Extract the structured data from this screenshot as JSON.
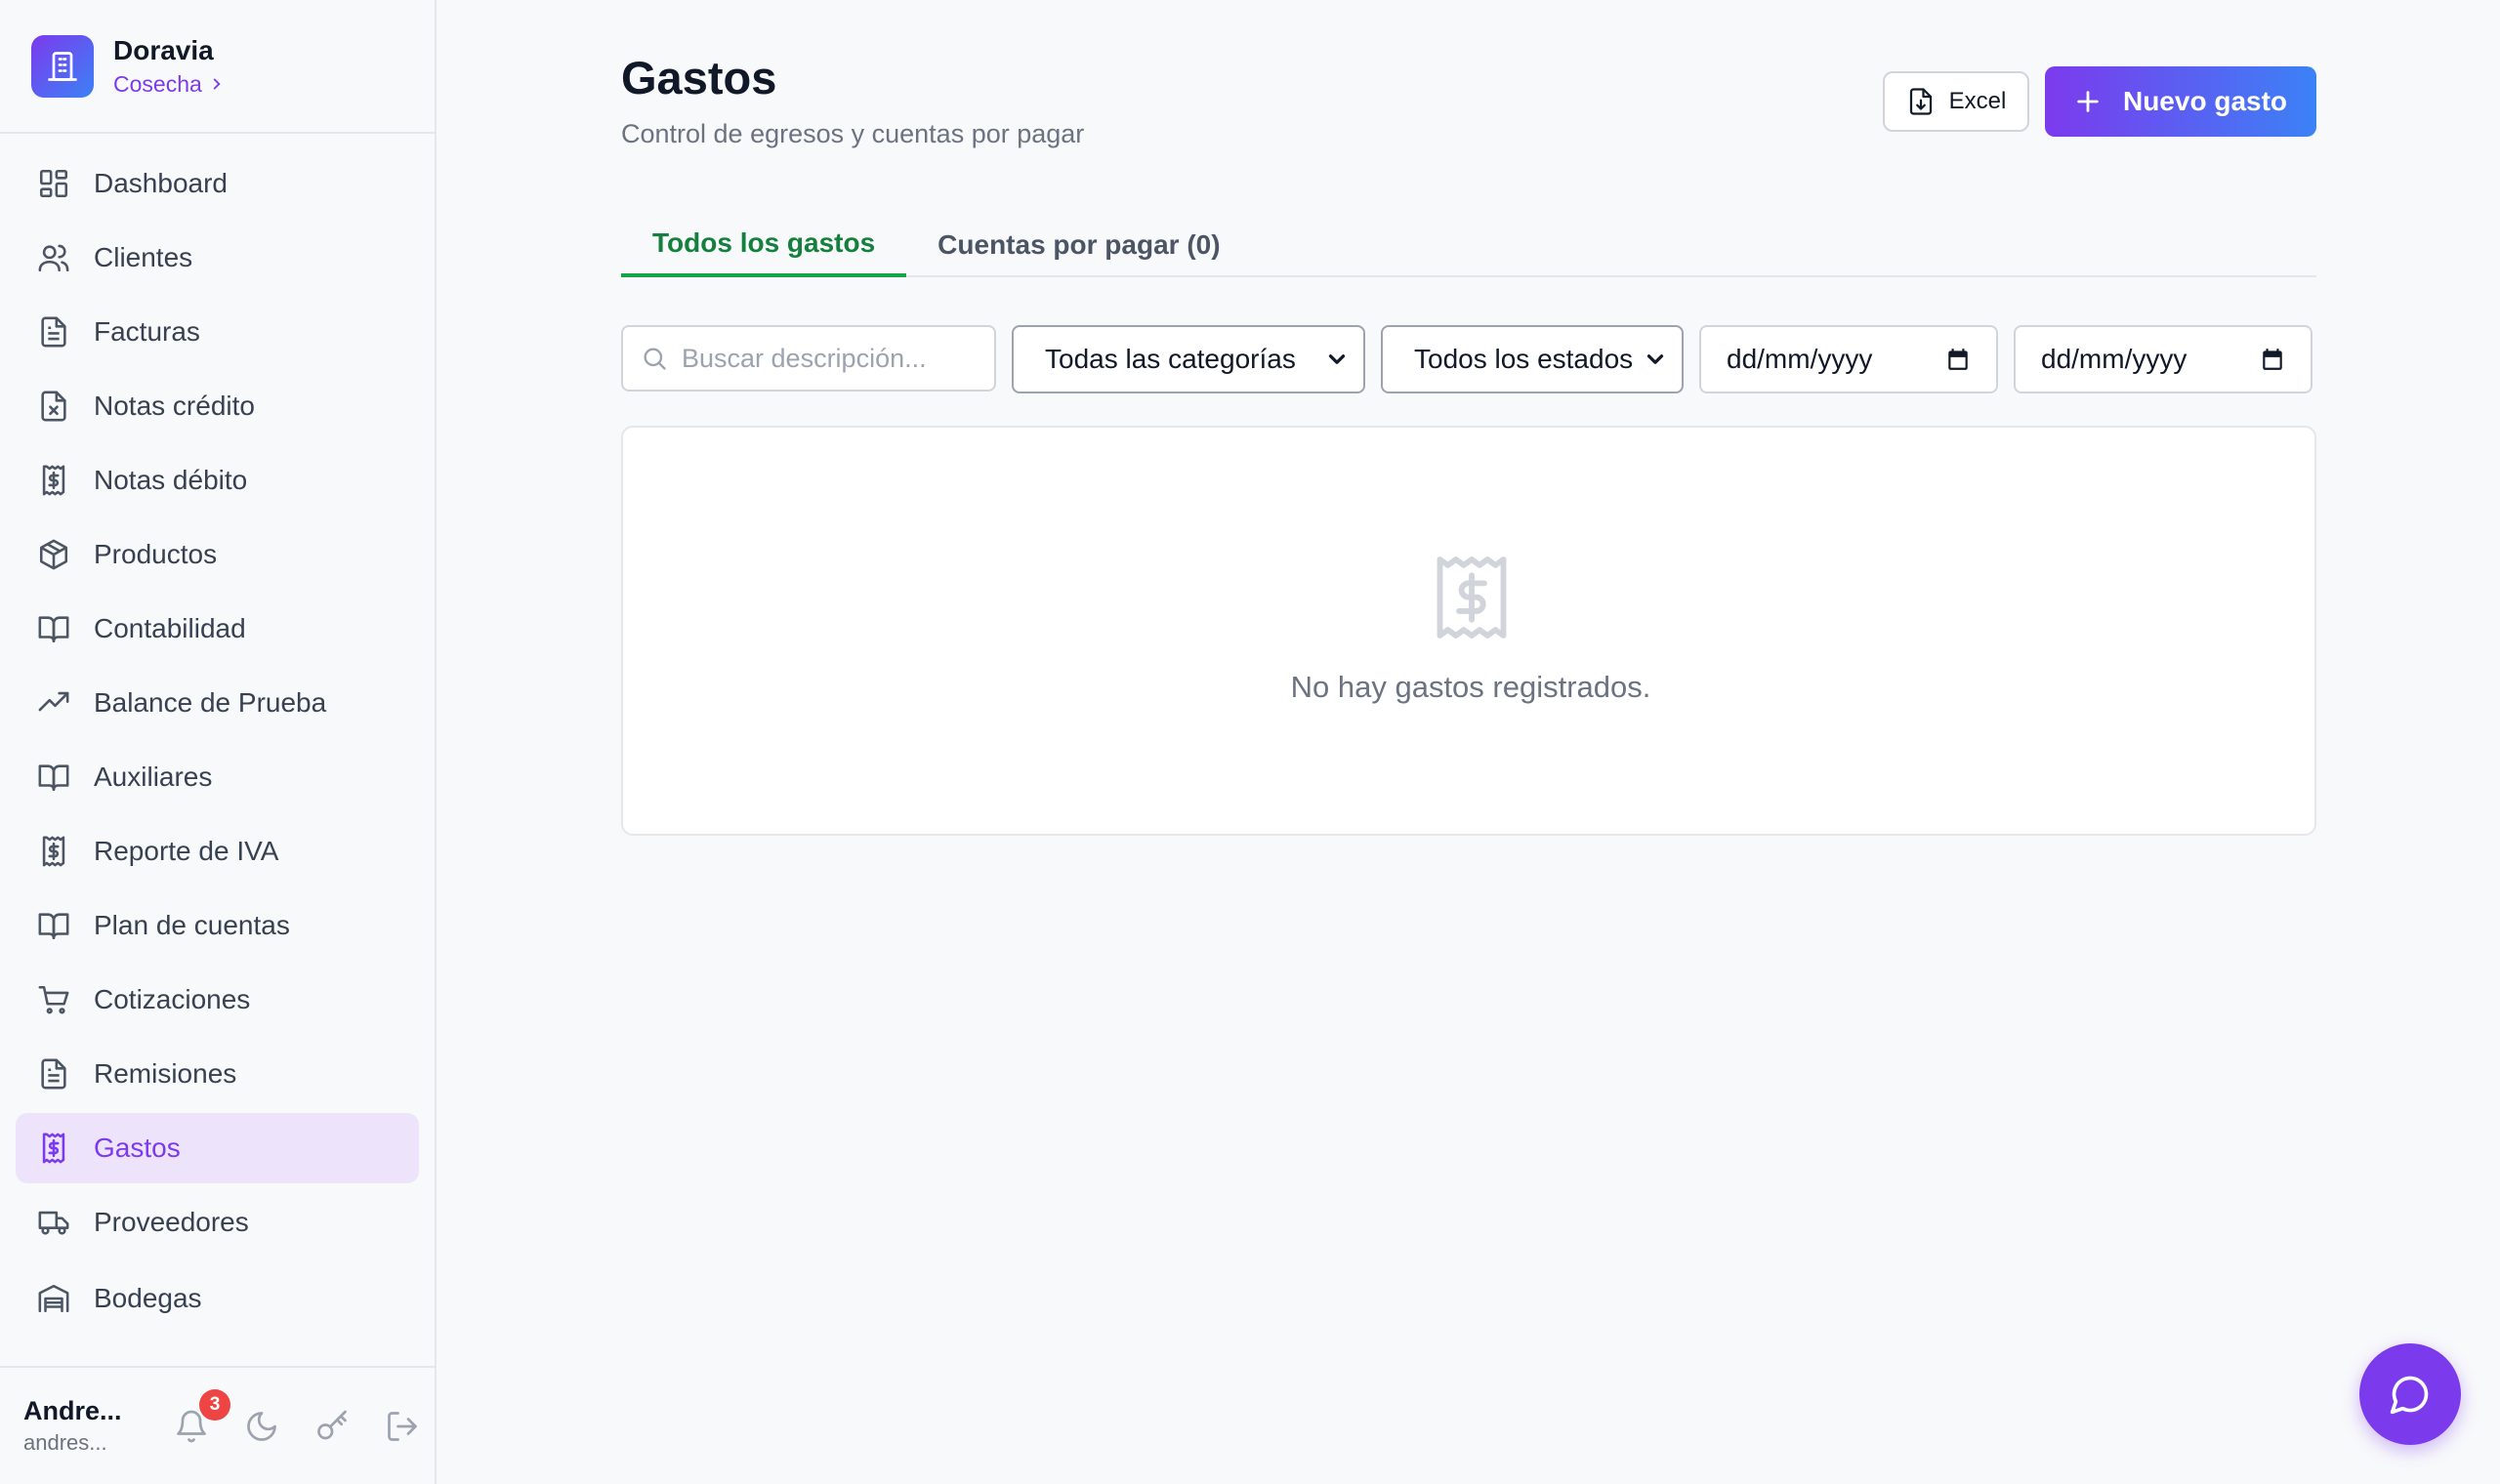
{
  "brand": {
    "name": "Doravia",
    "org": "Cosecha"
  },
  "nav": [
    {
      "label": "Dashboard",
      "icon": "dashboard-icon",
      "active": false
    },
    {
      "label": "Clientes",
      "icon": "users-icon",
      "active": false
    },
    {
      "label": "Facturas",
      "icon": "document-icon",
      "active": false
    },
    {
      "label": "Notas crédito",
      "icon": "document-x-icon",
      "active": false
    },
    {
      "label": "Notas débito",
      "icon": "receipt-dollar-icon",
      "active": false
    },
    {
      "label": "Productos",
      "icon": "box-icon",
      "active": false
    },
    {
      "label": "Contabilidad",
      "icon": "book-icon",
      "active": false
    },
    {
      "label": "Balance de Prueba",
      "icon": "trending-up-icon",
      "active": false
    },
    {
      "label": "Auxiliares",
      "icon": "book-icon",
      "active": false
    },
    {
      "label": "Reporte de IVA",
      "icon": "receipt-dollar-icon",
      "active": false
    },
    {
      "label": "Plan de cuentas",
      "icon": "book-icon",
      "active": false
    },
    {
      "label": "Cotizaciones",
      "icon": "cart-icon",
      "active": false
    },
    {
      "label": "Remisiones",
      "icon": "document-icon",
      "active": false
    },
    {
      "label": "Gastos",
      "icon": "receipt-dollar-icon",
      "active": true
    },
    {
      "label": "Proveedores",
      "icon": "truck-icon",
      "active": false
    },
    {
      "label": "Bodegas",
      "icon": "warehouse-icon",
      "active": false
    }
  ],
  "user": {
    "name": "Andre...",
    "email": "andres..."
  },
  "notifications": {
    "count": "3"
  },
  "page": {
    "title": "Gastos",
    "subtitle": "Control de egresos y cuentas por pagar",
    "excel_label": "Excel",
    "new_label": "Nuevo gasto"
  },
  "tabs": [
    {
      "label": "Todos los gastos",
      "active": true
    },
    {
      "label": "Cuentas por pagar (0)",
      "active": false
    }
  ],
  "filters": {
    "search_placeholder": "Buscar descripción...",
    "category": "Todas las categorías",
    "status": "Todos los estados",
    "date_from": "dd/mm/yyyy",
    "date_to": "dd/mm/yyyy"
  },
  "empty": {
    "message": "No hay gastos registrados."
  },
  "colors": {
    "accent": "#7c3aed",
    "accent_blue": "#3b82f6",
    "tab_active": "#16a34a"
  }
}
